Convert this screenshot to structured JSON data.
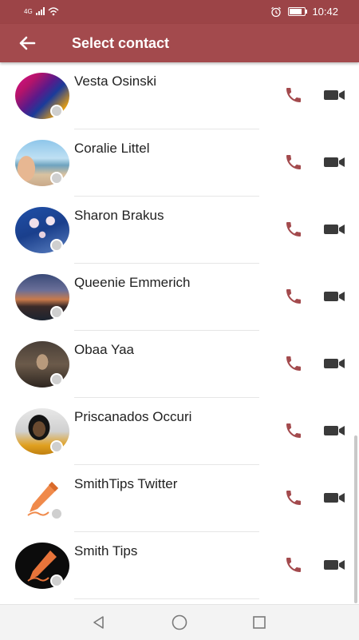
{
  "status_bar": {
    "network": "4G",
    "time": "10:42",
    "battery_level": 0.8,
    "icons": [
      "signal-icon",
      "wifi-icon",
      "alarm-icon",
      "battery-icon"
    ]
  },
  "toolbar": {
    "title": "Select contact",
    "back_icon": "arrow-left-icon"
  },
  "contacts": [
    {
      "name": "Vesta Osinski"
    },
    {
      "name": "Coralie Littel"
    },
    {
      "name": "Sharon Brakus"
    },
    {
      "name": "Queenie Emmerich"
    },
    {
      "name": "Obaa Yaa"
    },
    {
      "name": "Priscanados Occuri"
    },
    {
      "name": "SmithTips Twitter"
    },
    {
      "name": "Smith Tips"
    }
  ],
  "colors": {
    "status_bar": "#9c4447",
    "toolbar": "#a34a4d",
    "call_icon": "#a34a4d",
    "video_icon": "#3a3a3a",
    "presence": "#cfcfcf"
  },
  "nav_bar": {
    "icons": [
      "back-triangle-icon",
      "home-circle-icon",
      "recents-square-icon"
    ]
  }
}
